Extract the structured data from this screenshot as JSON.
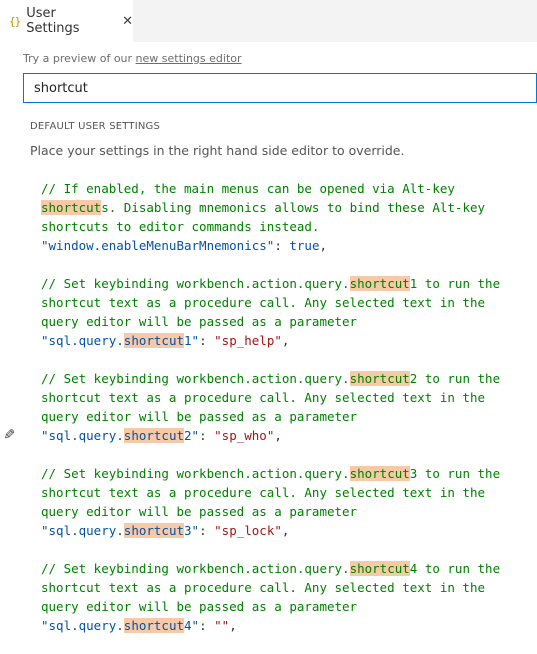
{
  "tab": {
    "icon": "{}",
    "title": "User Settings",
    "close_glyph": "✕"
  },
  "preview": {
    "prefix": "Try a preview of our ",
    "link_text": "new settings editor"
  },
  "search": {
    "value": "shortcut"
  },
  "section_header": "DEFAULT USER SETTINGS",
  "description": "Place your settings in the right hand side editor to override.",
  "settings": [
    {
      "comment_lines": [
        [
          "// If enabled, the main menus can be opened via Alt-key"
        ],
        [
          "",
          "shortcut",
          "s. Disabling mnemonics allows to bind these Alt-key"
        ],
        [
          "shortcuts to editor commands instead."
        ]
      ],
      "key_before": "\"window.enableMenuBarMnemonics",
      "key_highlight": "",
      "key_after": "\"",
      "value": "true",
      "value_type": "bool"
    },
    {
      "comment_lines": [
        [
          "// Set keybinding workbench.action.query.",
          "shortcut",
          "1 to run the"
        ],
        [
          "shortcut text as a procedure call. Any selected text in the"
        ],
        [
          "query editor will be passed as a parameter"
        ]
      ],
      "key_before": "\"sql.query.",
      "key_highlight": "shortcut",
      "key_after": "1\"",
      "value": "\"sp_help\"",
      "value_type": "string"
    },
    {
      "comment_lines": [
        [
          "// Set keybinding workbench.action.query.",
          "shortcut",
          "2 to run the"
        ],
        [
          "shortcut text as a procedure call. Any selected text in the"
        ],
        [
          "query editor will be passed as a parameter"
        ]
      ],
      "key_before": "\"sql.query.",
      "key_highlight": "shortcut",
      "key_after": "2\"",
      "value": "\"sp_who\"",
      "value_type": "string"
    },
    {
      "comment_lines": [
        [
          "// Set keybinding workbench.action.query.",
          "shortcut",
          "3 to run the"
        ],
        [
          "shortcut text as a procedure call. Any selected text in the"
        ],
        [
          "query editor will be passed as a parameter"
        ]
      ],
      "key_before": "\"sql.query.",
      "key_highlight": "shortcut",
      "key_after": "3\"",
      "value": "\"sp_lock\"",
      "value_type": "string"
    },
    {
      "comment_lines": [
        [
          "// Set keybinding workbench.action.query.",
          "shortcut",
          "4 to run the"
        ],
        [
          "shortcut text as a procedure call. Any selected text in the"
        ],
        [
          "query editor will be passed as a parameter"
        ]
      ],
      "key_before": "\"sql.query.",
      "key_highlight": "shortcut",
      "key_after": "4\"",
      "value": "\"\"",
      "value_type": "string"
    }
  ],
  "colors": {
    "comment": "#008000",
    "key": "#0451a5",
    "string": "#a31515",
    "highlight": "#f7c9a7",
    "search_border": "#0078d4"
  },
  "icons": {
    "tab_icon": "json-braces-icon",
    "close": "close-icon",
    "gutter": "edit-pencil-icon"
  }
}
